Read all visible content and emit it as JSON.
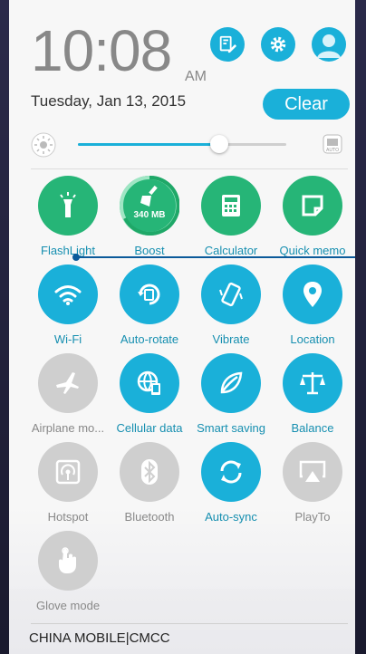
{
  "header": {
    "time": "10:08",
    "ampm": "AM",
    "date": "Tuesday, Jan 13, 2015",
    "clear_label": "Clear"
  },
  "tiles": [
    {
      "label": "FlashLight",
      "icon": "flashlight-icon",
      "state": "on-green"
    },
    {
      "label": "Boost",
      "icon": "broom-icon",
      "state": "on-green",
      "value": "340 MB"
    },
    {
      "label": "Calculator",
      "icon": "calculator-icon",
      "state": "on-green"
    },
    {
      "label": "Quick memo",
      "icon": "memo-icon",
      "state": "on-green"
    },
    {
      "label": "Wi-Fi",
      "icon": "wifi-icon",
      "state": "on"
    },
    {
      "label": "Auto-rotate",
      "icon": "auto-rotate-icon",
      "state": "on"
    },
    {
      "label": "Vibrate",
      "icon": "vibrate-icon",
      "state": "on"
    },
    {
      "label": "Location",
      "icon": "location-icon",
      "state": "on"
    },
    {
      "label": "Airplane mo...",
      "icon": "airplane-icon",
      "state": "off"
    },
    {
      "label": "Cellular data",
      "icon": "cellular-data-icon",
      "state": "on"
    },
    {
      "label": "Smart saving",
      "icon": "leaf-icon",
      "state": "on"
    },
    {
      "label": "Balance",
      "icon": "balance-icon",
      "state": "on"
    },
    {
      "label": "Hotspot",
      "icon": "hotspot-icon",
      "state": "off"
    },
    {
      "label": "Bluetooth",
      "icon": "bluetooth-icon",
      "state": "off"
    },
    {
      "label": "Auto-sync",
      "icon": "sync-icon",
      "state": "on"
    },
    {
      "label": "PlayTo",
      "icon": "playto-icon",
      "state": "off"
    },
    {
      "label": "Glove mode",
      "icon": "glove-icon",
      "state": "off"
    }
  ],
  "brightness": {
    "level": 0.68
  },
  "status": {
    "carrier": "CHINA MOBILE|CMCC"
  },
  "colors": {
    "accent": "#1ab0d9",
    "green": "#26b577",
    "off": "#cfcfcf"
  }
}
